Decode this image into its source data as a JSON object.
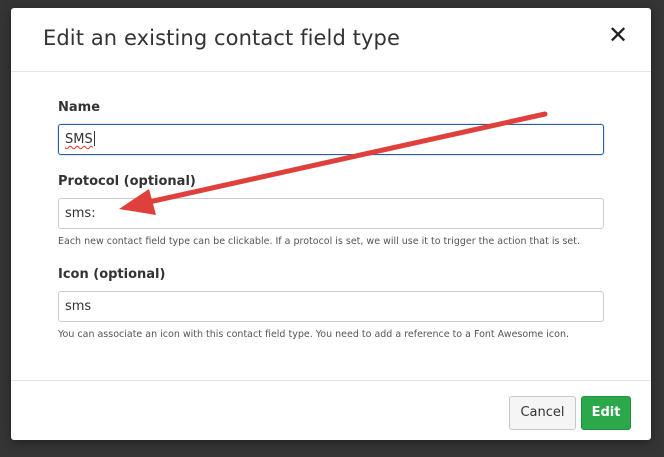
{
  "dialog": {
    "title": "Edit an existing contact field type",
    "close_glyph": "✕"
  },
  "fields": {
    "name": {
      "label": "Name",
      "value": "SMS"
    },
    "protocol": {
      "label": "Protocol (optional)",
      "value": "sms:",
      "help": "Each new contact field type can be clickable. If a protocol is set, we will use it to trigger the action that is set."
    },
    "icon": {
      "label": "Icon (optional)",
      "value": "sms",
      "help": "You can associate an icon with this contact field type. You need to add a reference to a Font Awesome icon."
    }
  },
  "footer": {
    "cancel_label": "Cancel",
    "edit_label": "Edit"
  },
  "colors": {
    "overlay": "#353535",
    "primary_button": "#2ba84a",
    "focus_border": "#2f5ea8",
    "annotation_arrow": "#e0403b"
  }
}
